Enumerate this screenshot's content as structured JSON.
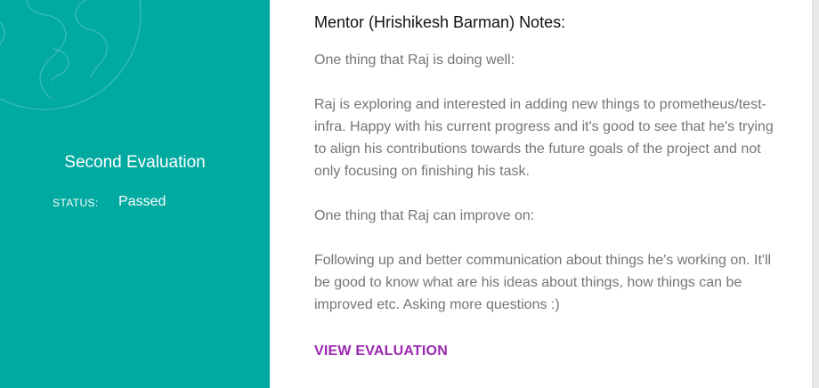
{
  "evaluation": {
    "title": "Second Evaluation",
    "status_label": "STATUS:",
    "status_value": "Passed"
  },
  "notes": {
    "title": "Mentor (Hrishikesh Barman) Notes:",
    "paragraphs": [
      "One thing that Raj is doing well:",
      "Raj is exploring and interested in adding new things to prometheus/test-infra. Happy with his current progress and it's good to see that he's trying to align his contributions towards the future goals of the project and not only focusing on finishing his task.",
      "One thing that Raj can improve on:",
      "Following up and better communication about things he's working on. It'll be good to know what are his ideas about things, how things can be improved etc. Asking more questions :)"
    ],
    "link_label": "VIEW EVALUATION"
  },
  "colors": {
    "sidebar": "#00aaa0",
    "link": "#9c27b0",
    "body_text": "#757575"
  },
  "icons": {
    "background": "globe-icon"
  }
}
